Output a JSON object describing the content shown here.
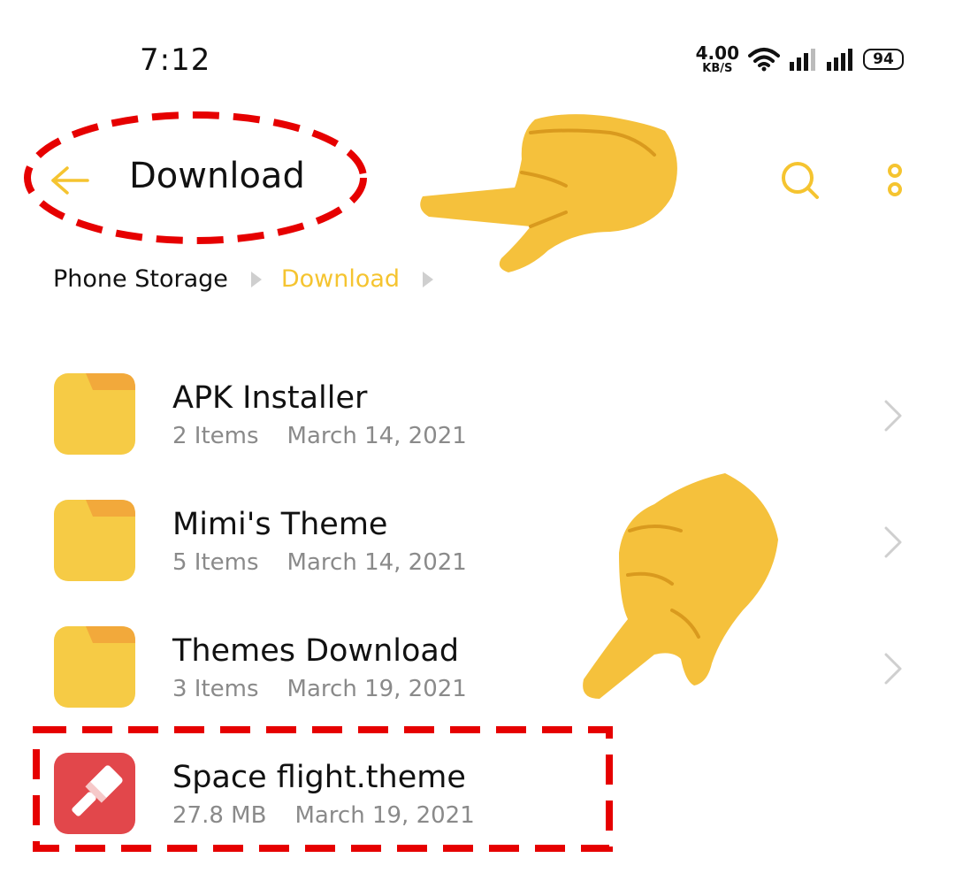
{
  "status_bar": {
    "time": "7:12",
    "net_speed_value": "4.00",
    "net_speed_unit": "KB/S",
    "battery": "94"
  },
  "header": {
    "title": "Download",
    "back_icon": "arrow-left-icon",
    "search_icon": "search-icon",
    "more_icon": "more-vertical-icon"
  },
  "breadcrumb": [
    "Phone Storage",
    "Download"
  ],
  "files": [
    {
      "name": "APK Installer",
      "info": "2 Items",
      "date": "March 14, 2021",
      "type": "folder"
    },
    {
      "name": "Mimi's Theme",
      "info": "5 Items",
      "date": "March 14, 2021",
      "type": "folder"
    },
    {
      "name": "Themes Download",
      "info": "3 Items",
      "date": "March 19, 2021",
      "type": "folder"
    },
    {
      "name": "Space flight.theme",
      "info": "27.8 MB",
      "date": "March 19, 2021",
      "type": "theme-file"
    }
  ],
  "colors": {
    "accent": "#f5c430",
    "folder": "#f6cb45",
    "folder_tab": "#f2a93b",
    "theme_file": "#e2474b",
    "annotation": "#e60000"
  }
}
